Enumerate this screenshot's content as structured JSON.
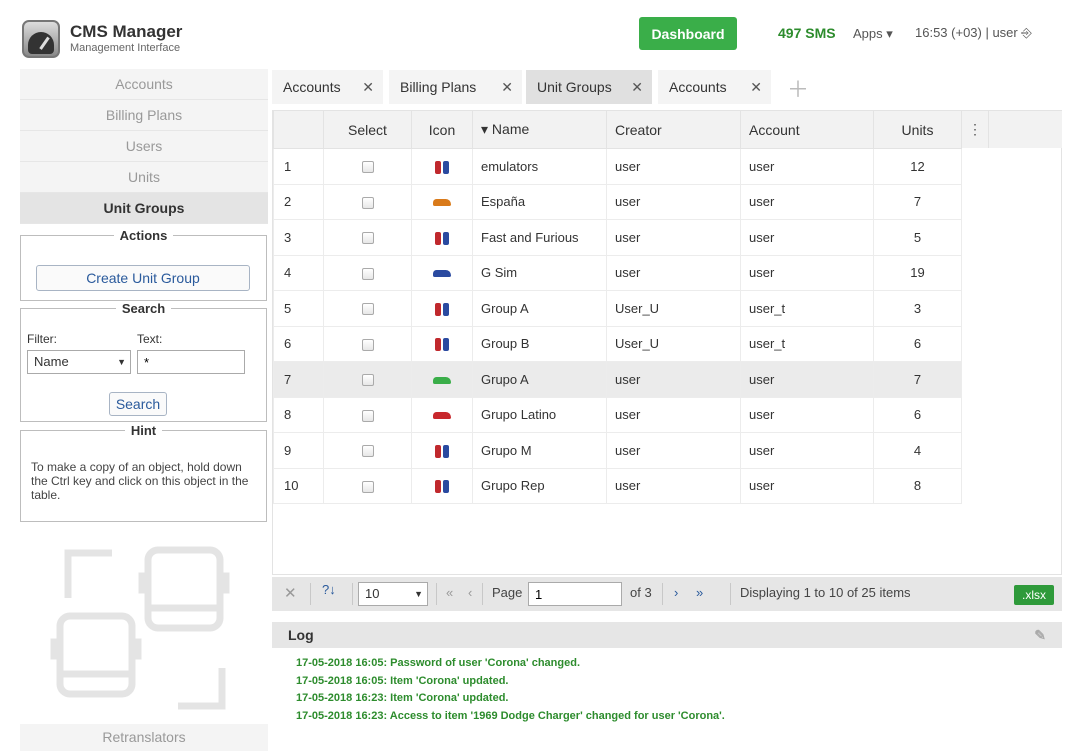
{
  "header": {
    "app_title": "CMS Manager",
    "app_subtitle": "Management Interface",
    "dashboard_label": "Dashboard",
    "sms_count": "497 SMS",
    "apps_label": "Apps ▾",
    "time_user": "16:53 (+03)  |  user ⎆"
  },
  "sidebar": {
    "items": [
      {
        "label": "Accounts"
      },
      {
        "label": "Billing Plans"
      },
      {
        "label": "Users"
      },
      {
        "label": "Units"
      },
      {
        "label": "Unit Groups"
      }
    ],
    "actions": {
      "title": "Actions",
      "create_label": "Create Unit Group"
    },
    "search": {
      "title": "Search",
      "filter_label": "Filter:",
      "text_label": "Text:",
      "filter_value": "Name",
      "text_value": "*",
      "button_label": "Search"
    },
    "hint": {
      "title": "Hint",
      "text": "To make a copy of an object, hold down the Ctrl key and click on this object in the table."
    },
    "bottom_item": "Retranslators"
  },
  "tabs": [
    {
      "label": "Accounts"
    },
    {
      "label": "Billing Plans"
    },
    {
      "label": "Unit Groups"
    },
    {
      "label": "Accounts"
    }
  ],
  "table": {
    "columns": [
      "",
      "Select",
      "Icon",
      "▾ Name",
      "Creator",
      "Account",
      "Units",
      "⋮"
    ],
    "rows": [
      {
        "n": "1",
        "name": "emulators",
        "creator": "user",
        "account": "user",
        "units": "12",
        "icon": "phones-icon"
      },
      {
        "n": "2",
        "name": "España",
        "creator": "user",
        "account": "user",
        "units": "7",
        "icon": "car-icon"
      },
      {
        "n": "3",
        "name": "Fast and Furious",
        "creator": "user",
        "account": "user",
        "units": "5",
        "icon": "phones-icon"
      },
      {
        "n": "4",
        "name": "G Sim",
        "creator": "user",
        "account": "user",
        "units": "19",
        "icon": "car-icon"
      },
      {
        "n": "5",
        "name": "Group A",
        "creator": "User_U",
        "account": "user_t",
        "units": "3",
        "icon": "phones-icon"
      },
      {
        "n": "6",
        "name": "Group B",
        "creator": "User_U",
        "account": "user_t",
        "units": "6",
        "icon": "phones-icon"
      },
      {
        "n": "7",
        "name": "Grupo A",
        "creator": "user",
        "account": "user",
        "units": "7",
        "icon": "car-icon"
      },
      {
        "n": "8",
        "name": "Grupo Latino",
        "creator": "user",
        "account": "user",
        "units": "6",
        "icon": "car-icon"
      },
      {
        "n": "9",
        "name": "Grupo M",
        "creator": "user",
        "account": "user",
        "units": "4",
        "icon": "phones-icon"
      },
      {
        "n": "10",
        "name": "Grupo Rep",
        "creator": "user",
        "account": "user",
        "units": "8",
        "icon": "phones-icon"
      }
    ]
  },
  "pager": {
    "page_size": "10",
    "page_label": "Page",
    "page_value": "1",
    "of_label": "of 3",
    "display_text": "Displaying 1 to 10 of 25 items",
    "export_label": ".xlsx"
  },
  "log": {
    "title": "Log",
    "lines": [
      "17-05-2018 16:05: Password of user 'Corona' changed.",
      "17-05-2018 16:05: Item 'Corona' updated.",
      "17-05-2018 16:23: Item 'Corona' updated.",
      "17-05-2018 16:23: Access to item '1969 Dodge Charger' changed for user 'Corona'."
    ]
  },
  "colors": {
    "accent_green": "#3aae49",
    "log_green": "#2d8c2d",
    "link_blue": "#2a5a9c"
  }
}
